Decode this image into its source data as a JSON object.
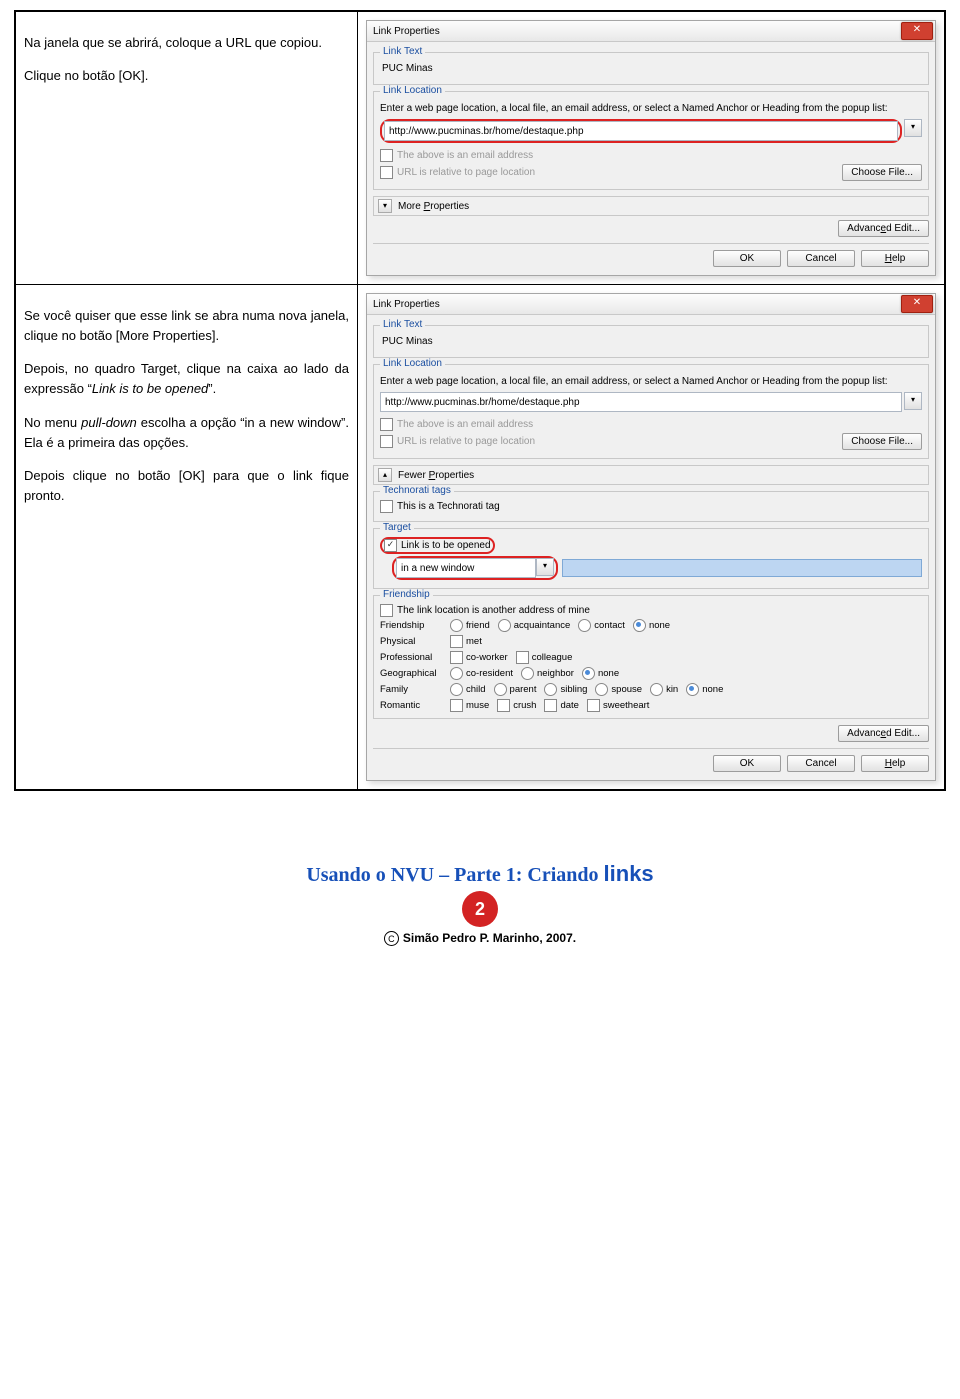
{
  "instructions": {
    "row1": {
      "p1": "Na janela que se abrirá, coloque a URL que copiou.",
      "p2": "Clique no botão [OK]."
    },
    "row2": {
      "p1": "Se você quiser que esse link se abra numa nova janela, clique no botão [More Properties].",
      "p2_a": "Depois, no quadro Target, clique na caixa ao lado da expressão “",
      "p2_i": "Link is to be opened",
      "p2_b": "”.",
      "p3_a": "No menu ",
      "p3_i": "pull-down",
      "p3_b": " escolha a opção “in a new window”. Ela é a primeira das opções.",
      "p4": "Depois clique no botão [OK] para que o link fique pronto."
    }
  },
  "dialog1": {
    "title": "Link Properties",
    "linktext_legend": "Link Text",
    "linktext_value": "PUC Minas",
    "linkloc_legend": "Link Location",
    "linkloc_desc": "Enter a web page location, a local file, an email address, or select a Named Anchor or Heading from the popup list:",
    "url": "http://www.pucminas.br/home/destaque.php",
    "cb_email": "The above is an email address",
    "cb_relative": "URL is relative to page location",
    "choose": "Choose File...",
    "more": "More Properties",
    "adv": "Advanced Edit...",
    "ok": "OK",
    "cancel": "Cancel",
    "help": "Help"
  },
  "dialog2": {
    "title": "Link Properties",
    "linktext_legend": "Link Text",
    "linktext_value": "PUC Minas",
    "linkloc_legend": "Link Location",
    "linkloc_desc": "Enter a web page location, a local file, an email address, or select a Named Anchor or Heading from the popup list:",
    "url": "http://www.pucminas.br/home/destaque.php",
    "cb_email": "The above is an email address",
    "cb_relative": "URL is relative to page location",
    "choose": "Choose File...",
    "fewer": "Fewer Properties",
    "tech_legend": "Technorati tags",
    "tech_cb": "This is a Technorati tag",
    "target_legend": "Target",
    "target_cb": "Link is to be opened",
    "target_sel": "in a new window",
    "friend_legend": "Friendship",
    "friend_cb_another": "The link location is another address of mine",
    "rows": {
      "friendship": {
        "label": "Friendship",
        "opts": [
          "friend",
          "acquaintance",
          "contact",
          "none"
        ],
        "sel": "none",
        "type": "radio"
      },
      "physical": {
        "label": "Physical",
        "opts": [
          "met"
        ],
        "type": "check"
      },
      "professional": {
        "label": "Professional",
        "opts": [
          "co-worker",
          "colleague"
        ],
        "type": "check"
      },
      "geographical": {
        "label": "Geographical",
        "opts": [
          "co-resident",
          "neighbor",
          "none"
        ],
        "sel": "none",
        "type": "radio"
      },
      "family": {
        "label": "Family",
        "opts": [
          "child",
          "parent",
          "sibling",
          "spouse",
          "kin",
          "none"
        ],
        "sel": "none",
        "type": "radio"
      },
      "romantic": {
        "label": "Romantic",
        "opts": [
          "muse",
          "crush",
          "date",
          "sweetheart"
        ],
        "type": "check"
      }
    },
    "adv": "Advanced Edit...",
    "ok": "OK",
    "cancel": "Cancel",
    "help": "Help"
  },
  "footer": {
    "title_a": "Usando o NVU – Parte 1: Criando ",
    "title_b": "links",
    "page": "2",
    "copyright": "Simão Pedro P. Marinho, 2007."
  }
}
